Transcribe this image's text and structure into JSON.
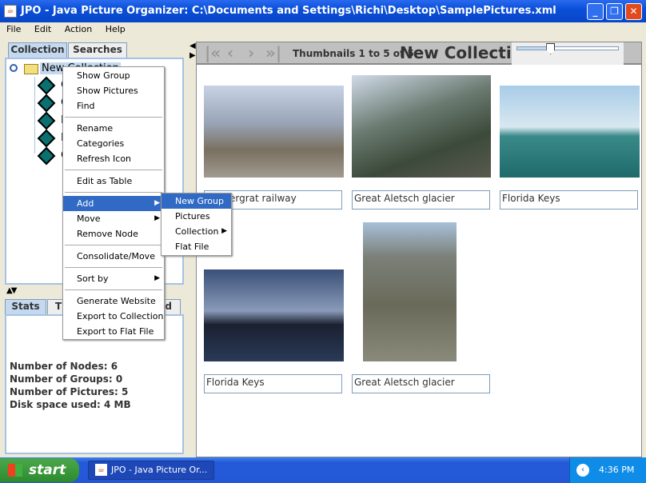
{
  "window": {
    "title": "JPO - Java Picture Organizer:  C:\\Documents and Settings\\Richi\\Desktop\\SamplePictures.xml",
    "controls": [
      "minimize",
      "maximize",
      "close"
    ]
  },
  "menubar": [
    "File",
    "Edit",
    "Action",
    "Help"
  ],
  "left_tabs": [
    "Collection",
    "Searches"
  ],
  "tree": {
    "root": "New Collection",
    "children": [
      "G",
      "G",
      "F",
      "F",
      "G"
    ]
  },
  "bottom_tabs": [
    "Stats",
    "Th",
    "nd"
  ],
  "stats": [
    "Number of Nodes: 6",
    "Number of Groups: 0",
    "Number of Pictures: 5",
    "Disk space used: 4 MB"
  ],
  "context_menu": [
    [
      "Show Group",
      "Show Pictures",
      "Find"
    ],
    [
      "Rename",
      "Categories",
      "Refresh Icon"
    ],
    [
      "Edit as Table"
    ],
    [
      "Add",
      "Move",
      "Remove Node"
    ],
    [
      "Consolidate/Move"
    ],
    [
      "Sort by"
    ],
    [
      "Generate Website",
      "Export to Collection",
      "Export to Flat File"
    ]
  ],
  "context_menu_submenus": [
    "Add",
    "Move",
    "Sort by"
  ],
  "context_menu_highlighted": "Add",
  "submenu": {
    "items": [
      "New Group",
      "Pictures",
      "Collection",
      "Flat File"
    ],
    "highlighted": "New Group",
    "submenus": [
      "Collection"
    ]
  },
  "toolbar": {
    "nav_icons": [
      "first-icon",
      "previous-icon",
      "next-icon",
      "last-icon"
    ],
    "status": "Thumbnails 1 to 5 of 5",
    "title": "New Collection",
    "zoom_slider_fraction": 0.33
  },
  "thumbnails": [
    {
      "caption": "Gornergrat railway",
      "visible_caption": "rgrat railway"
    },
    {
      "caption": "Great Aletsch glacier"
    },
    {
      "caption": "Florida Keys"
    },
    {
      "caption": "Florida Keys"
    },
    {
      "caption": "Great Aletsch glacier"
    }
  ],
  "taskbar": {
    "start": "start",
    "task": "JPO - Java Picture Or...",
    "clock": "4:36 PM"
  },
  "colors": {
    "titlebar": "#0a4fd8",
    "highlight": "#316ac5",
    "tab_selected": "#c4d9f0"
  }
}
